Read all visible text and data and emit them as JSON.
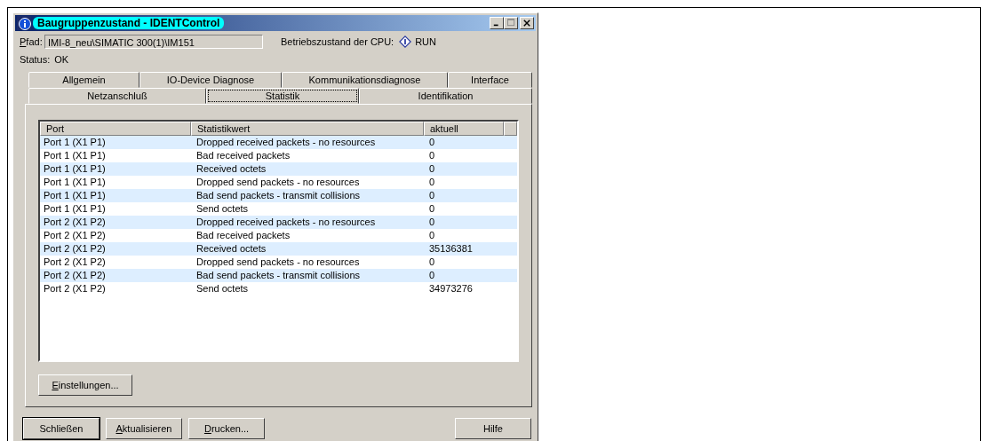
{
  "window": {
    "title": "Baugruppenzustand - IDENTControl"
  },
  "path": {
    "label": "Pfad:",
    "underline_first": true,
    "value": "IMI-8_neu\\SIMATIC 300(1)\\IM151"
  },
  "cpu": {
    "label": "Betriebszustand der CPU:",
    "value": "RUN"
  },
  "status": {
    "label": "Status:",
    "value": "OK"
  },
  "tab_rows": [
    [
      {
        "label": "Allgemein",
        "selected": false
      },
      {
        "label": "IO-Device Diagnose",
        "selected": false
      },
      {
        "label": "Kommunikationsdiagnose",
        "selected": false
      },
      {
        "label": "Interface",
        "selected": false
      }
    ],
    [
      {
        "label": "Netzanschluß",
        "selected": false
      },
      {
        "label": "Statistik",
        "selected": true
      },
      {
        "label": "Identifikation",
        "selected": false
      }
    ]
  ],
  "table": {
    "columns": [
      "Port",
      "Statistikwert",
      "aktuell"
    ],
    "rows": [
      [
        "Port 1 (X1 P1)",
        "Dropped received packets - no resources",
        "0"
      ],
      [
        "Port 1 (X1 P1)",
        "Bad received packets",
        "0"
      ],
      [
        "Port 1 (X1 P1)",
        "Received octets",
        "0"
      ],
      [
        "Port 1 (X1 P1)",
        "Dropped send packets - no resources",
        "0"
      ],
      [
        "Port 1 (X1 P1)",
        "Bad send packets - transmit collisions",
        "0"
      ],
      [
        "Port 1 (X1 P1)",
        "Send octets",
        "0"
      ],
      [
        "Port 2 (X1 P2)",
        "Dropped received packets - no resources",
        "0"
      ],
      [
        "Port 2 (X1 P2)",
        "Bad received packets",
        "0"
      ],
      [
        "Port 2 (X1 P2)",
        "Received octets",
        "35136381"
      ],
      [
        "Port 2 (X1 P2)",
        "Dropped send packets - no resources",
        "0"
      ],
      [
        "Port 2 (X1 P2)",
        "Bad send packets - transmit collisions",
        "0"
      ],
      [
        "Port 2 (X1 P2)",
        "Send octets",
        "34973276"
      ]
    ]
  },
  "settings_button": {
    "label": "Einstellungen...",
    "underline_first": true
  },
  "buttons": [
    {
      "label": "Schließen",
      "underline_first": false,
      "default": true
    },
    {
      "label": "Aktualisieren",
      "underline_first": true,
      "default": false
    },
    {
      "label": "Drucken...",
      "underline_first": true,
      "default": false
    }
  ],
  "help_button": {
    "label": "Hilfe",
    "underline_first": false
  }
}
